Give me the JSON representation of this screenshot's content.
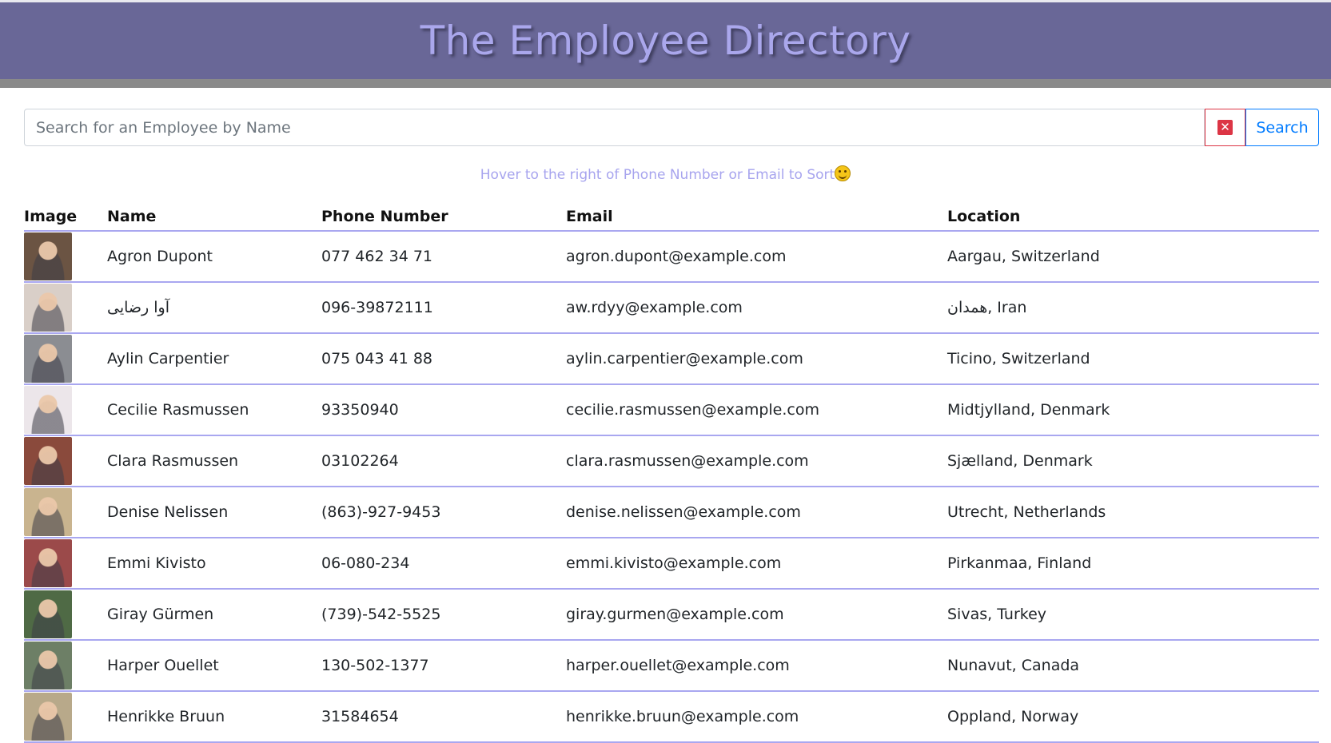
{
  "header": {
    "title": "The Employee Directory"
  },
  "search": {
    "placeholder": "Search for an Employee by Name",
    "value": "",
    "clear_icon": "x-square-icon",
    "button_label": "Search"
  },
  "hint": {
    "text": "Hover to the right of Phone Number or Email to Sort",
    "emoji_icon": "smiling-face-icon"
  },
  "table": {
    "columns": [
      "Image",
      "Name",
      "Phone Number",
      "Email",
      "Location"
    ],
    "rows": [
      {
        "name": "Agron Dupont",
        "phone": "077 462 34 71",
        "email": "agron.dupont@example.com",
        "location": "Aargau, Switzerland",
        "avatar_color": "#6b5443"
      },
      {
        "name": "آوا رضایی",
        "phone": "096-39872111",
        "email": "aw.rdyy@example.com",
        "location": "همدان, Iran",
        "avatar_color": "#d9cfc8"
      },
      {
        "name": "Aylin Carpentier",
        "phone": "075 043 41 88",
        "email": "aylin.carpentier@example.com",
        "location": "Ticino, Switzerland",
        "avatar_color": "#8b8d92"
      },
      {
        "name": "Cecilie Rasmussen",
        "phone": "93350940",
        "email": "cecilie.rasmussen@example.com",
        "location": "Midtjylland, Denmark",
        "avatar_color": "#ece6ea"
      },
      {
        "name": "Clara Rasmussen",
        "phone": "03102264",
        "email": "clara.rasmussen@example.com",
        "location": "Sjælland, Denmark",
        "avatar_color": "#8a4a3c"
      },
      {
        "name": "Denise Nelissen",
        "phone": "(863)-927-9453",
        "email": "denise.nelissen@example.com",
        "location": "Utrecht, Netherlands",
        "avatar_color": "#c9b48f"
      },
      {
        "name": "Emmi Kivisto",
        "phone": "06-080-234",
        "email": "emmi.kivisto@example.com",
        "location": "Pirkanmaa, Finland",
        "avatar_color": "#9b4a4a"
      },
      {
        "name": "Giray Gürmen",
        "phone": "(739)-542-5525",
        "email": "giray.gurmen@example.com",
        "location": "Sivas, Turkey",
        "avatar_color": "#4f6a45"
      },
      {
        "name": "Harper Ouellet",
        "phone": "130-502-1377",
        "email": "harper.ouellet@example.com",
        "location": "Nunavut, Canada",
        "avatar_color": "#6d7f66"
      },
      {
        "name": "Henrikke Bruun",
        "phone": "31584654",
        "email": "henrikke.bruun@example.com",
        "location": "Oppland, Norway",
        "avatar_color": "#b8a98a"
      }
    ]
  }
}
